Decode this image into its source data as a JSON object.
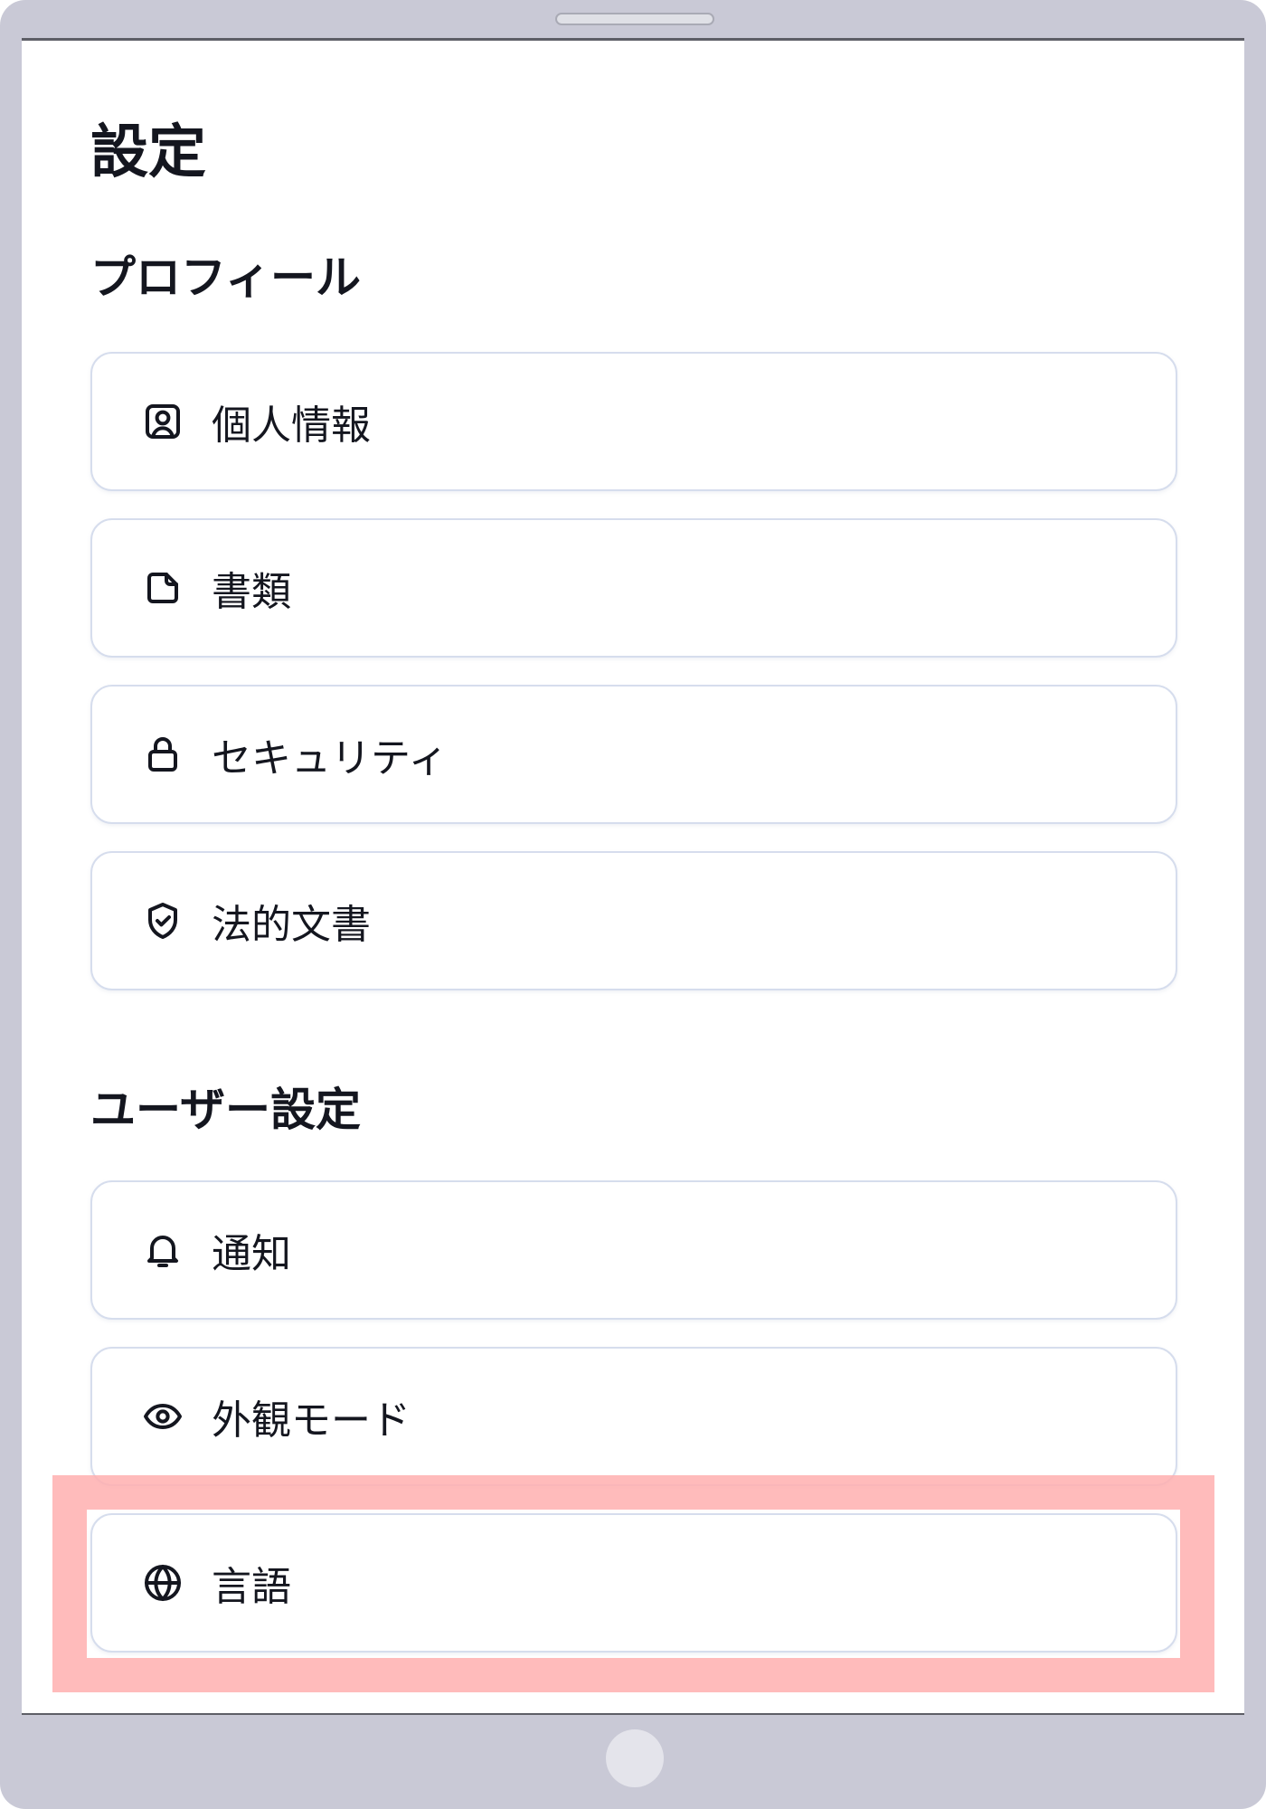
{
  "page": {
    "title": "設定"
  },
  "sections": [
    {
      "title": "プロフィール",
      "items": [
        {
          "label": "個人情報",
          "icon": "user-square-icon"
        },
        {
          "label": "書類",
          "icon": "document-icon"
        },
        {
          "label": "セキュリティ",
          "icon": "lock-icon"
        },
        {
          "label": "法的文書",
          "icon": "shield-check-icon"
        }
      ]
    },
    {
      "title": "ユーザー設定",
      "items": [
        {
          "label": "通知",
          "icon": "bell-icon"
        },
        {
          "label": "外観モード",
          "icon": "eye-icon"
        },
        {
          "label": "言語",
          "icon": "globe-icon"
        }
      ]
    }
  ],
  "colors": {
    "text": "#14161f",
    "card_border": "#d6dded",
    "device_frame": "#c9c9d6",
    "highlight": "#ffafaf"
  }
}
